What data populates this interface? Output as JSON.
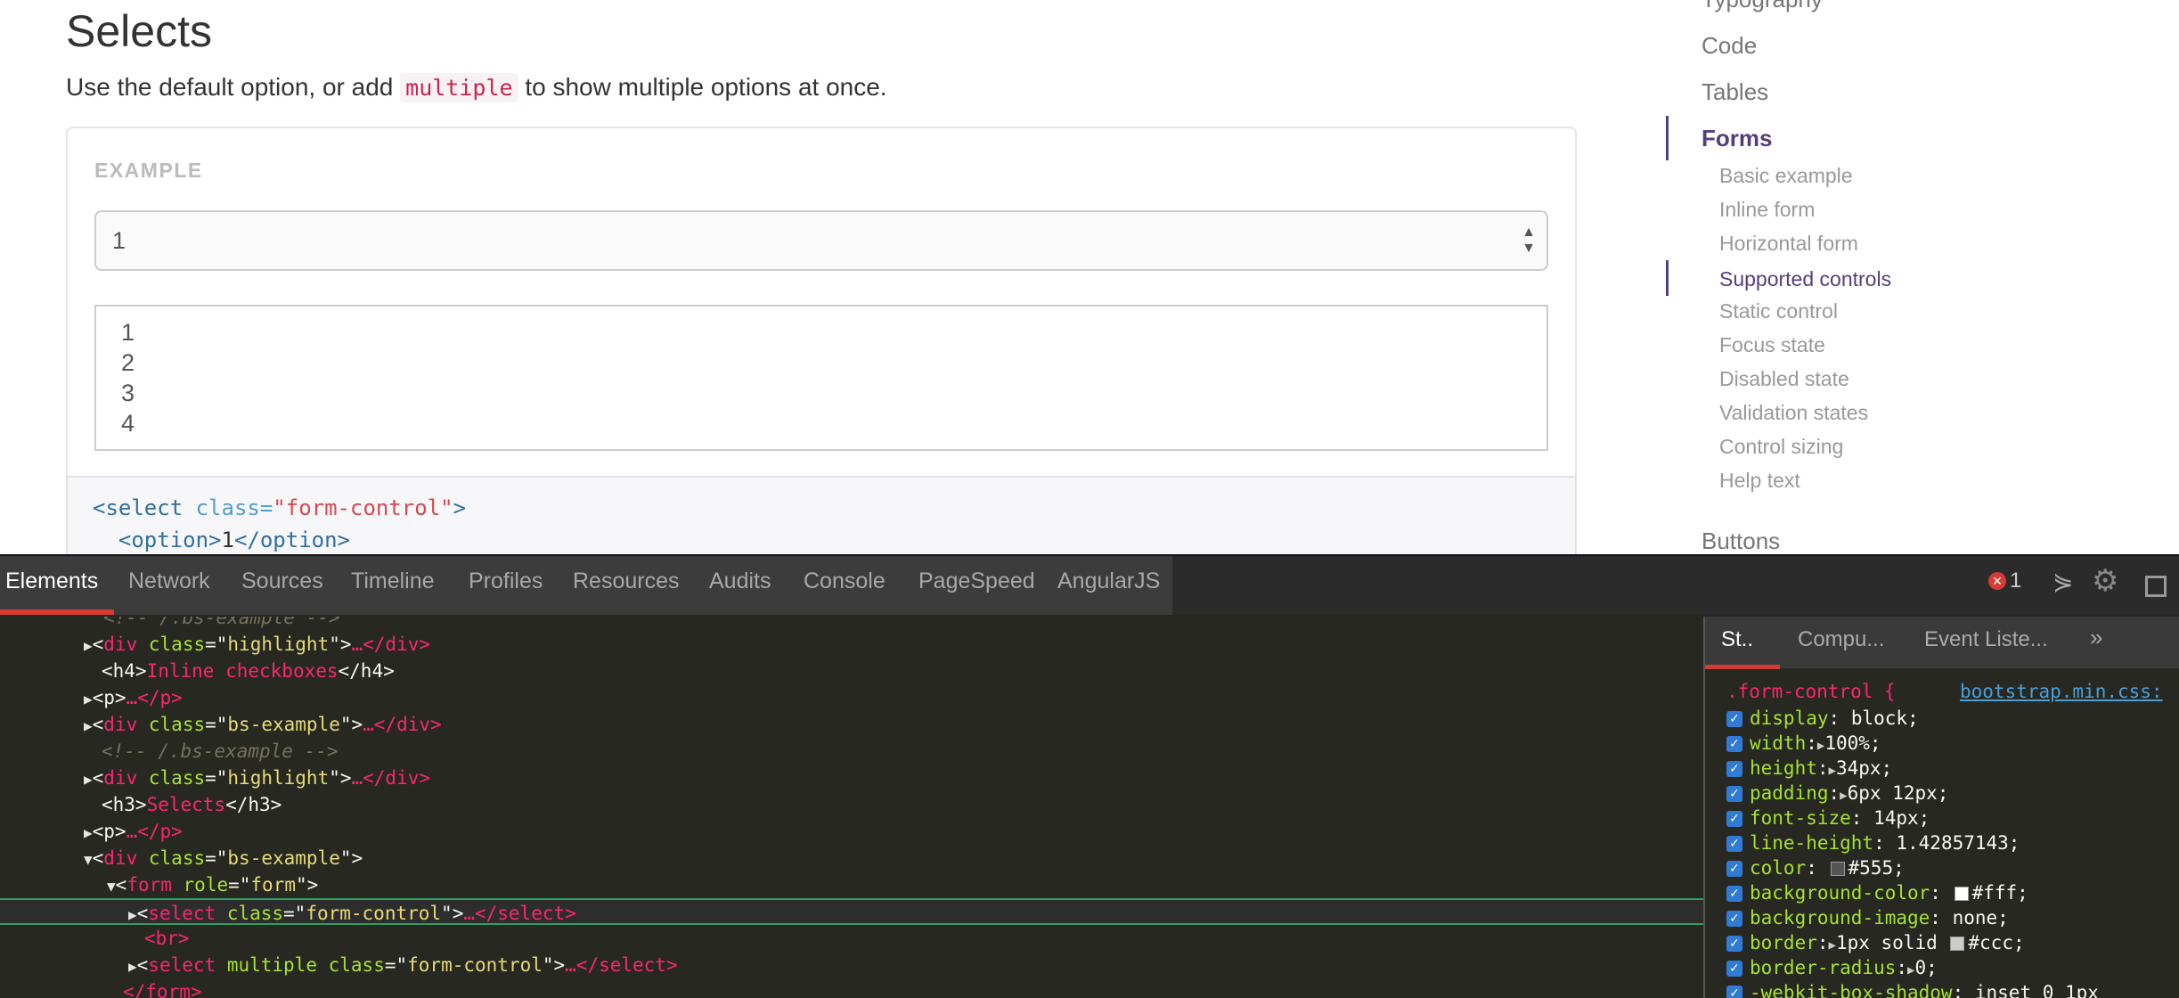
{
  "page": {
    "title": "Selects",
    "lead_before": "Use the default option, or add ",
    "lead_code": "multiple",
    "lead_after": " to show multiple options at once.",
    "example_label": "EXAMPLE",
    "single_select_value": "1",
    "multi_options": [
      "1",
      "2",
      "3",
      "4"
    ],
    "code_lines": {
      "line1": {
        "open": "<select ",
        "attr": "class=",
        "str": "\"form-control\"",
        "close": ">"
      },
      "line2": {
        "open": "  <option>",
        "txt": "1",
        "close": "</option>"
      }
    }
  },
  "side_nav": {
    "top_items": [
      "Typography",
      "Code",
      "Tables",
      "Forms",
      "Buttons"
    ],
    "forms_sub": [
      "Basic example",
      "Inline form",
      "Horizontal form",
      "Supported controls",
      "Static control",
      "Focus state",
      "Disabled state",
      "Validation states",
      "Control sizing",
      "Help text"
    ],
    "active_top": "Forms",
    "active_sub": "Supported controls",
    "accent_color": "#563d7c"
  },
  "devtools": {
    "tabs": [
      "Elements",
      "Network",
      "Sources",
      "Timeline",
      "Profiles",
      "Resources",
      "Audits",
      "Console",
      "PageSpeed",
      "AngularJS"
    ],
    "active_tab": "Elements",
    "error_count": "1",
    "icons": [
      "error-icon",
      "console-drawer-icon",
      "gear-icon",
      "dock-icon"
    ],
    "elements": {
      "top_comment": "<!-- /.bs-example -->",
      "l1": {
        "tag": "div",
        "attr": "class",
        "val": "highlight",
        "tail": "…</div>"
      },
      "l2": {
        "open": "<h4>",
        "text": "Inline checkboxes",
        "close": "</h4>"
      },
      "l3": {
        "open": "<p>",
        "tail": "…</p>"
      },
      "l4": {
        "tag": "div",
        "attr": "class",
        "val": "bs-example",
        "tail": "…</div>"
      },
      "l5": {
        "comment": "<!-- /.bs-example -->"
      },
      "l6": {
        "tag": "div",
        "attr": "class",
        "val": "highlight",
        "tail": "…</div>"
      },
      "l7": {
        "open": "<h3>",
        "text": "Selects",
        "close": "</h3>"
      },
      "l8": {
        "open": "<p>",
        "tail": "…</p>"
      },
      "l9": {
        "tag": "div",
        "attr": "class",
        "val": "bs-example"
      },
      "l10": {
        "tag": "form",
        "attr": "role",
        "val": "form"
      },
      "l11": {
        "tag": "select",
        "attr": "class",
        "val": "form-control",
        "tail": "…</select>"
      },
      "l12": {
        "open": "<br>"
      },
      "l13": {
        "tag": "select",
        "pre": "multiple",
        "attr": "class",
        "val": "form-control",
        "tail": "…</select>"
      },
      "l14": {
        "close": "</form>"
      }
    },
    "styles": {
      "tabs": [
        "St..",
        "Compu...",
        "Event Liste..."
      ],
      "more": "»",
      "selector": ".form-control {",
      "source": "bootstrap.min.css:",
      "props": [
        {
          "name": "display",
          "value": "block;"
        },
        {
          "name": "width",
          "value": "100%;",
          "expand": true
        },
        {
          "name": "height",
          "value": "34px;",
          "expand": true
        },
        {
          "name": "padding",
          "value": "6px 12px;",
          "expand": true
        },
        {
          "name": "font-size",
          "value": "14px;"
        },
        {
          "name": "line-height",
          "value": "1.42857143;"
        },
        {
          "name": "color",
          "value": "#555;",
          "swatch": "#555555"
        },
        {
          "name": "background-color",
          "value": "#fff;",
          "swatch": "#ffffff"
        },
        {
          "name": "background-image",
          "value": "none;"
        },
        {
          "name": "border",
          "value": "1px solid ",
          "value2": "#ccc;",
          "expand": true,
          "swatch": "#cccccc"
        },
        {
          "name": "border-radius",
          "value": "0;",
          "expand": true
        },
        {
          "name": "-webkit-box-shadow",
          "value": "inset 0 1px"
        }
      ]
    }
  }
}
